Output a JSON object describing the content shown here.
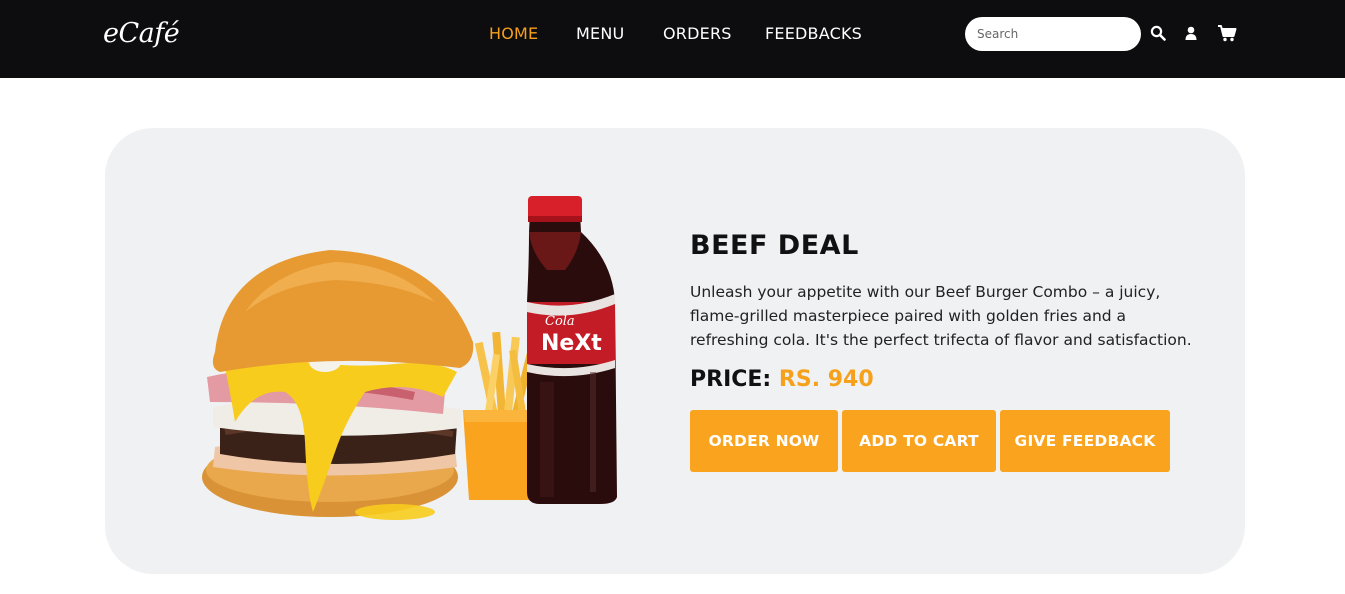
{
  "brand": {
    "name": "eCafé"
  },
  "nav": {
    "links": [
      {
        "label": "HOME",
        "active": true
      },
      {
        "label": "MENU",
        "active": false
      },
      {
        "label": "ORDERS",
        "active": false
      },
      {
        "label": "FEEDBACKS",
        "active": false
      }
    ],
    "search": {
      "placeholder": "Search",
      "value": ""
    },
    "icons": [
      "search-icon",
      "user-icon",
      "cart-icon"
    ]
  },
  "product": {
    "title": "BEEF DEAL",
    "description": "Unleash your appetite with our Beef Burger Combo – a juicy, flame-grilled masterpiece paired with golden fries and a refreshing cola. It's the perfect trifecta of flavor and satisfaction.",
    "price_label": "PRICE:",
    "price_value": "RS. 940",
    "image_label": {
      "brand": "Cola",
      "name": "NeXt"
    },
    "buttons": {
      "order": "ORDER NOW",
      "cart": "ADD TO CART",
      "feedback": "GIVE FEEDBACK"
    }
  },
  "colors": {
    "accent": "#f9a31f",
    "navbar_bg": "#0d0d0f",
    "card_bg": "#f0f1f3",
    "text_dark": "#111111"
  }
}
